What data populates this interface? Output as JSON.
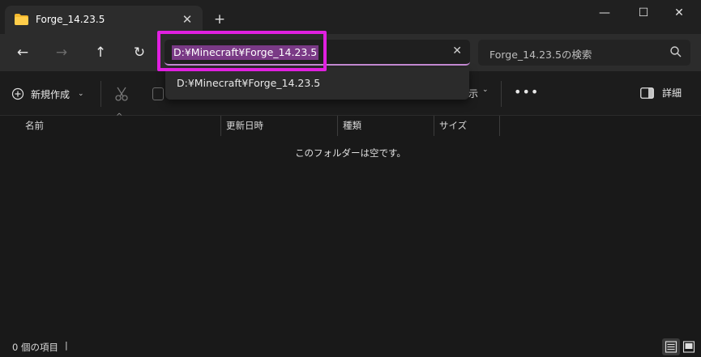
{
  "window": {
    "tab_title": "Forge_14.23.5",
    "minimize": "—",
    "maximize": "☐",
    "close": "✕"
  },
  "nav": {
    "address_value": "D:¥Minecraft¥Forge_14.23.5",
    "search_placeholder": "Forge_14.23.5の検索"
  },
  "dropdown": {
    "items": [
      "D:¥Minecraft¥Forge_14.23.5"
    ]
  },
  "toolbar": {
    "new_label": "新規作成",
    "view_label_partial": "示",
    "details_label": "詳細"
  },
  "columns": [
    "名前",
    "更新日時",
    "種類",
    "サイズ"
  ],
  "main": {
    "empty_message": "このフォルダーは空です。"
  },
  "status": {
    "item_count": "0 個の項目",
    "caret": "|"
  },
  "colors": {
    "accent_highlight": "#e020e0",
    "selection": "#7a3a86",
    "address_underline": "#c78bd6"
  }
}
